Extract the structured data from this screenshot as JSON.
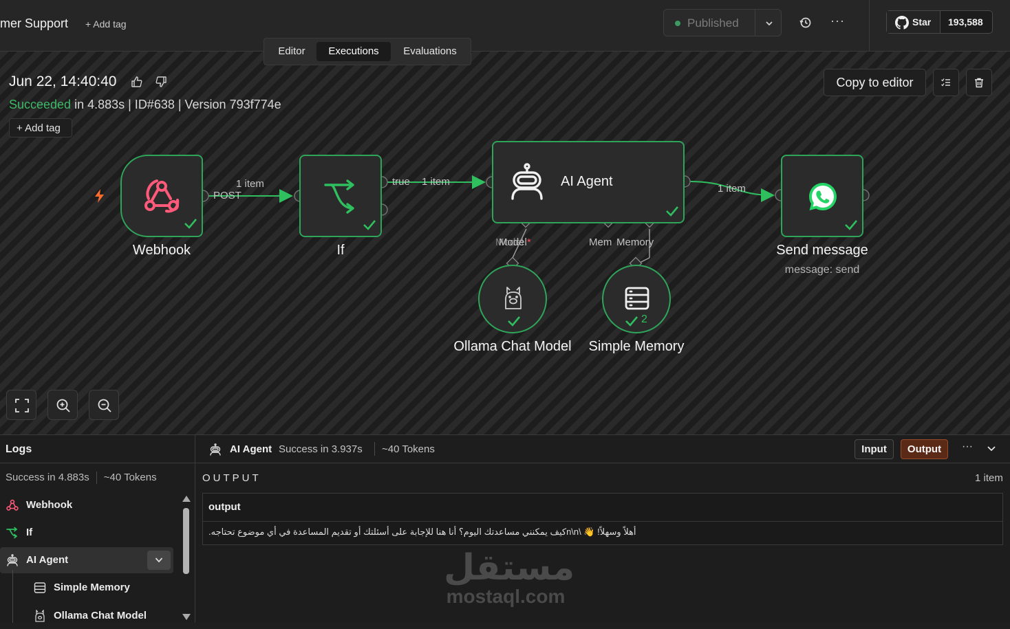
{
  "header": {
    "workflow_name": "mer Support",
    "add_tag": "+ Add tag",
    "published_label": "Published",
    "more": "···",
    "github": {
      "star_label": "Star",
      "count": "193,588"
    }
  },
  "tabs": [
    {
      "label": "Editor"
    },
    {
      "label": "Executions"
    },
    {
      "label": "Evaluations"
    }
  ],
  "execution": {
    "date": "Jun 22, 14:40:40",
    "status": "Succeeded",
    "meta_rest": " in 4.883s | ID#638 | Version 793f774e",
    "add_tag": "+ Add tag",
    "copy_to_editor": "Copy to editor"
  },
  "nodes": {
    "webhook": {
      "label": "Webhook"
    },
    "if": {
      "label": "If"
    },
    "agent": {
      "label": "AI Agent"
    },
    "send": {
      "label": "Send message",
      "sub": "message: send"
    },
    "ollama": {
      "label": "Ollama Chat Model"
    },
    "memory": {
      "label": "Simple Memory",
      "badge": "2"
    }
  },
  "edges": {
    "post": "POST",
    "item1": "1 item",
    "true": "true",
    "item2": "1 item",
    "item3": "1 item",
    "model": "Model",
    "model_ghost": "Model",
    "model_star": "*",
    "memory": "Memory",
    "memory_ghost": "Mem"
  },
  "logs": {
    "title": "Logs",
    "summary_status": "Success in 4.883s",
    "summary_tokens": "~40 Tokens",
    "items": [
      {
        "label": "Webhook"
      },
      {
        "label": "If"
      },
      {
        "label": "AI Agent"
      },
      {
        "label": "Simple Memory"
      },
      {
        "label": "Ollama Chat Model"
      }
    ]
  },
  "output_panel": {
    "node_name": "AI Agent",
    "status": "Success in 3.937s",
    "tokens": "~40 Tokens",
    "input_btn": "Input",
    "output_btn": "Output",
    "more": "···",
    "title": "OUTPUT",
    "count": "1 item",
    "column": "output",
    "value": "أهلاً وسهلاً! 👋 \\n\\nكيف يمكنني مساعدتك اليوم؟ أنا هنا للإجابة على أسئلتك أو تقديم المساعدة في أي موضوع تحتاجه."
  },
  "watermark": {
    "arabic": "مستقل",
    "latin": "mostaql.com"
  },
  "colors": {
    "success": "#3fb868",
    "node_border": "#2fa55a",
    "webhook": "#ff5a7a",
    "whatsapp": "#25d366",
    "output_btn": "#5a2a17",
    "trigger": "#ff6d2e"
  }
}
